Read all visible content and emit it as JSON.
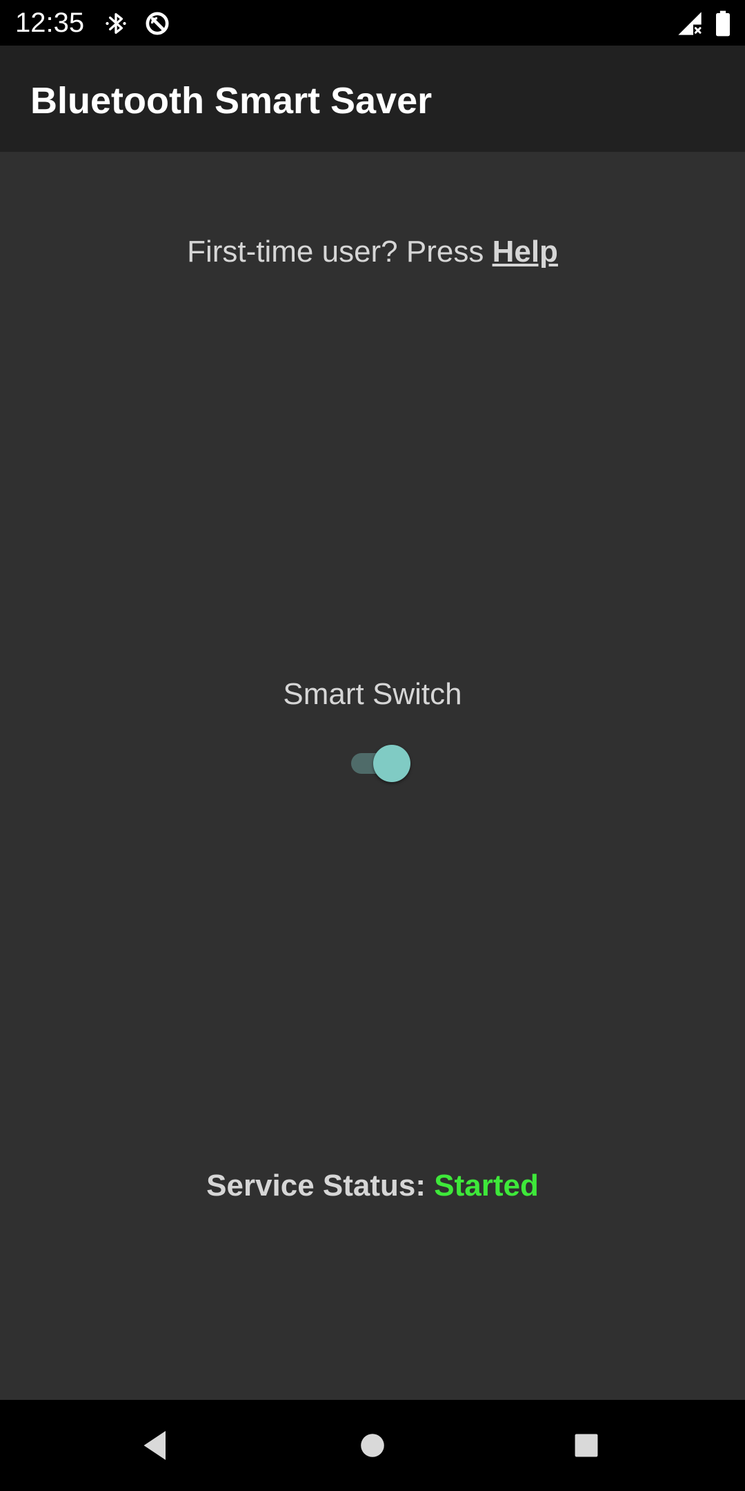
{
  "status_bar": {
    "time": "12:35",
    "icons": [
      "bluetooth-icon",
      "data-saver-icon",
      "cell-signal-icon",
      "battery-icon"
    ]
  },
  "app_bar": {
    "title": "Bluetooth Smart Saver"
  },
  "help": {
    "prefix": "First-time user? Press ",
    "link_label": "Help"
  },
  "smart_switch": {
    "label": "Smart Switch",
    "checked": true,
    "thumb_color": "#80cbc4",
    "track_color": "#4f6b69"
  },
  "service": {
    "label": "Service Status: ",
    "value": "Started",
    "value_color": "#3ee83a"
  },
  "nav_bar": {
    "buttons": [
      "back-icon",
      "home-icon",
      "recents-icon"
    ]
  },
  "colors": {
    "background": "#303030",
    "app_bar": "#212121",
    "status_bar": "#000000"
  }
}
